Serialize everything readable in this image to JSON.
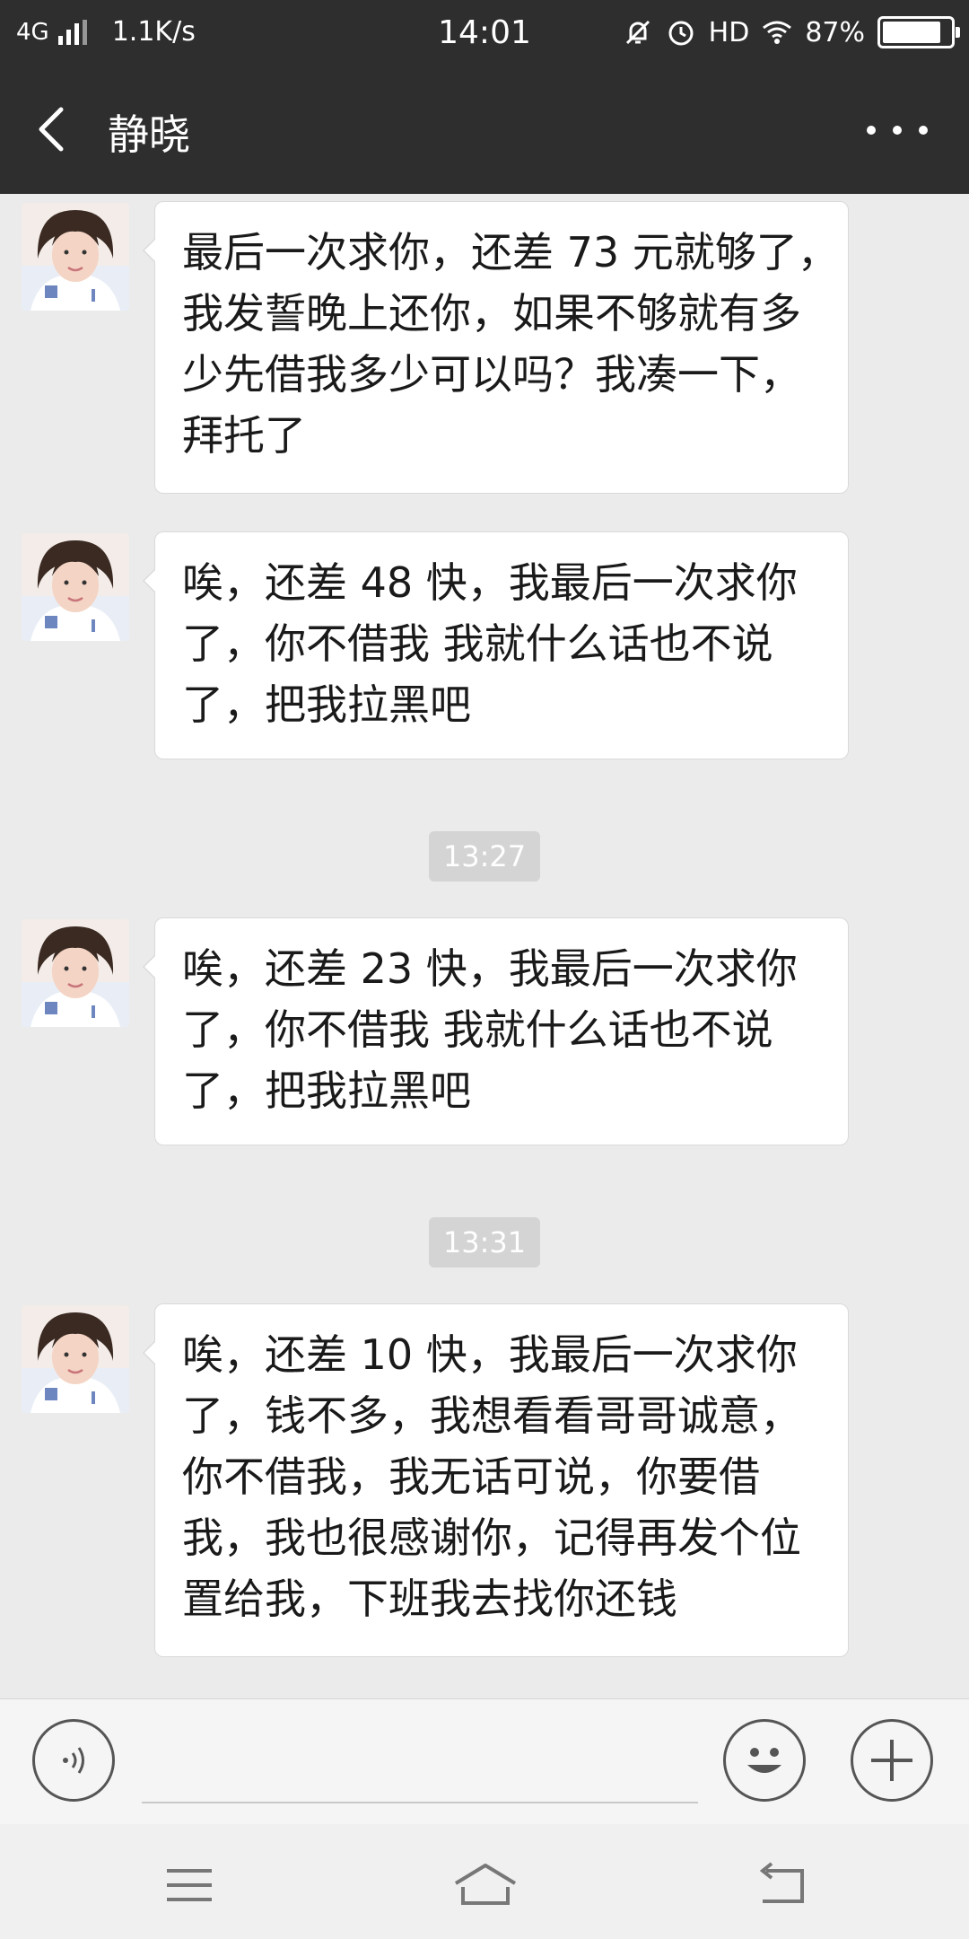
{
  "status_bar": {
    "network": "4G",
    "speed": "1.1K/s",
    "time": "14:01",
    "hd": "HD",
    "battery": "87%",
    "battery_level": 0.87,
    "icons": [
      "signal-icon",
      "mute-icon",
      "alarm-icon",
      "wifi-icon",
      "battery-icon"
    ]
  },
  "header": {
    "title": "静晓",
    "back_icon": "chevron-left-icon",
    "more_icon": "more-dots-icon"
  },
  "messages": [
    {
      "type": "message",
      "lines": [
        "最后一次求你，还差 73 元就够了，",
        "我发誓晚上还你，如果不够就有多",
        "少先借我多少可以吗？我凑一下，",
        "拜托了"
      ]
    },
    {
      "type": "message",
      "lines": [
        "唉，还差 48 快，我最后一次求你",
        "了，你不借我 我就什么话也不说",
        "了，把我拉黑吧"
      ]
    },
    {
      "type": "timestamp",
      "text": "13:27"
    },
    {
      "type": "message",
      "lines": [
        "唉，还差 23 快，我最后一次求你",
        "了，你不借我 我就什么话也不说",
        "了，把我拉黑吧"
      ]
    },
    {
      "type": "timestamp",
      "text": "13:31"
    },
    {
      "type": "message",
      "lines": [
        "唉，还差 10 快，我最后一次求你",
        "了，钱不多，我想看看哥哥诚意，",
        "你不借我，我无话可说，你要借",
        "我，我也很感谢你，记得再发个位",
        "置给我，下班我去找你还钱"
      ]
    }
  ],
  "input_bar": {
    "voice_icon": "voice-icon",
    "emoji_icon": "emoji-icon",
    "plus_icon": "plus-icon"
  },
  "nav_bar": {
    "icons": [
      "menu-icon",
      "home-icon",
      "back-icon"
    ]
  },
  "colors": {
    "header_bg": "#2e2e2e",
    "chat_bg": "#ebebeb",
    "bubble_bg": "#ffffff",
    "timestamp_bg": "#d4d4d4"
  }
}
